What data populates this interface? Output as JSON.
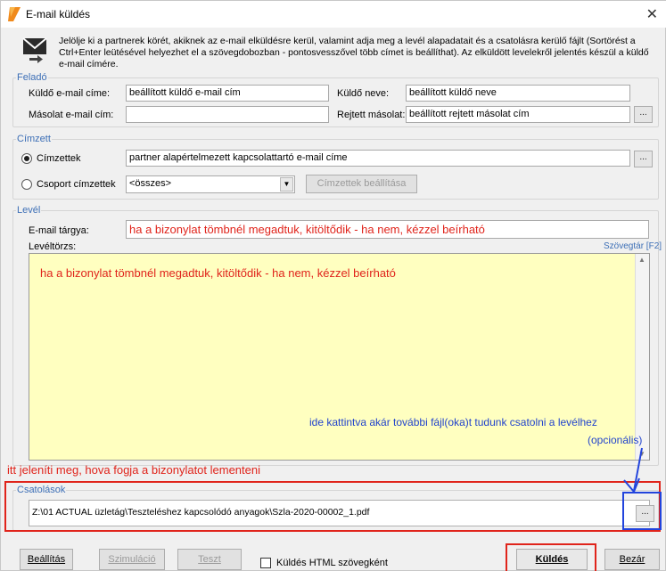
{
  "window": {
    "title": "E-mail küldés",
    "close_glyph": "✕",
    "info_text": "Jelölje ki a partnerek körét, akiknek az e-mail elküldésre kerül, valamint adja meg a levél alapadatait és a csatolásra kerülő fájlt (Sortörést a Ctrl+Enter leütésével helyezhet el a szövegdobozban - pontosvesszővel több címet is beállíthat). Az elküldött levelekről jelentés készül a küldő e-mail címére."
  },
  "sender": {
    "group_title": "Feladó",
    "sender_email_label": "Küldő e-mail címe:",
    "sender_email_value": "beállított küldő e-mail cím",
    "sender_name_label": "Küldő neve:",
    "sender_name_value": "beállított küldő neve",
    "cc_label": "Másolat e-mail cím:",
    "cc_value": "",
    "bcc_label": "Rejtett másolat:",
    "bcc_value": "beállított rejtett másolat cím",
    "dots": "..."
  },
  "recipients": {
    "group_title": "Címzett",
    "recipients_label": "Címzettek",
    "recipients_value": "partner alapértelmezett kapcsolattartó e-mail címe",
    "group_label": "Csoport címzettek",
    "group_select_value": "<összes>",
    "settings_button": "Címzettek beállítása",
    "dots": "..."
  },
  "letter": {
    "group_title": "Levél",
    "subject_label": "E-mail tárgya:",
    "subject_value": "ha a bizonylat tömbnél megadtuk, kitöltődik - ha nem, kézzel beírható",
    "body_label": "Levéltörzs:",
    "text_library_link": "Szövegtár [F2]",
    "body_value": "ha a bizonylat tömbnél megadtuk, kitöltődik - ha nem, kézzel beírható"
  },
  "annotations": {
    "attach_hint_line1": "ide kattintva akár további fájl(oka)t tudunk csatolni a levélhez",
    "attach_hint_line2": "(opcionális)",
    "save_location_hint": "itt jeleníti meg, hova fogja a bizonylatot lementeni"
  },
  "attachments": {
    "group_title": "Csatolások",
    "path": "Z:\\01 ACTUAL üzletág\\Teszteléshez kapcsolódó anyagok\\Szla-2020-00002_1.pdf",
    "dots": "..."
  },
  "footer": {
    "settings_button": "Beállítás",
    "simulation_button": "Szimuláció",
    "test_button": "Teszt",
    "html_checkbox_label": "Küldés HTML szövegként",
    "send_button": "Küldés",
    "close_button": "Bezár"
  },
  "colors": {
    "accent_blue": "#3d6fb6",
    "annotation_red": "#e0241b",
    "annotation_blue": "#2244dd",
    "body_background": "#ffffc0"
  }
}
